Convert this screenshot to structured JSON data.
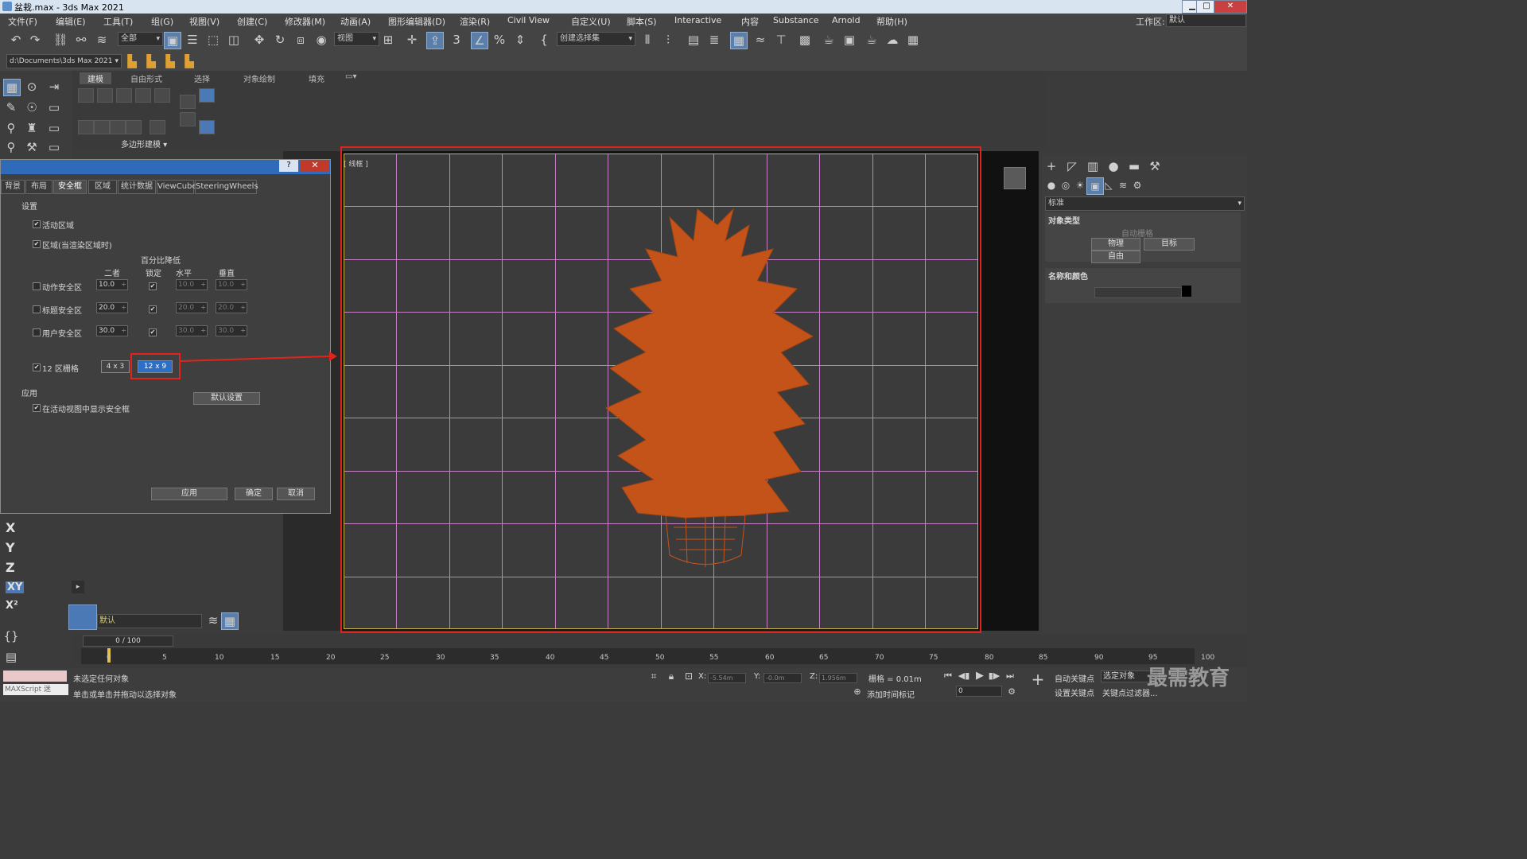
{
  "window": {
    "title": "盆栽.max - 3ds Max 2021",
    "min": "▁",
    "max": "□",
    "close": "✕"
  },
  "menu": [
    "文件(F)",
    "编辑(E)",
    "工具(T)",
    "组(G)",
    "视图(V)",
    "创建(C)",
    "修改器(M)",
    "动画(A)",
    "图形编辑器(D)",
    "渲染(R)",
    "Civil View",
    "自定义(U)",
    "脚本(S)",
    "Interactive",
    "内容",
    "Substance",
    "Arnold",
    "帮助(H)"
  ],
  "workspace": {
    "label": "工作区:",
    "value": "默认"
  },
  "toolbar": {
    "filter": "全部",
    "refcoord": "视图",
    "selset": "创建选择集"
  },
  "toolbar2": {
    "path": "d:\\Documents\\3ds Max 2021"
  },
  "ribbon": {
    "tabs": [
      "建模",
      "自由形式",
      "选择",
      "对象绘制",
      "填充"
    ],
    "group": "多边形建模 ▾"
  },
  "viewport": {
    "label": "[ 线框 ]"
  },
  "dialog": {
    "help": "?",
    "close": "✕",
    "tabs": [
      "背景",
      "布局",
      "安全框",
      "区域",
      "统计数据",
      "ViewCube",
      "SteeringWheels"
    ],
    "settings_label": "设置",
    "live_area": "活动区域",
    "region_render": "区域(当渲染区域时)",
    "pct_reduce": "百分比降低",
    "cols": [
      "二者",
      "锁定",
      "水平",
      "垂直"
    ],
    "rows": [
      {
        "label": "动作安全区",
        "both": "10.0",
        "h": "10.0",
        "v": "10.0"
      },
      {
        "label": "标题安全区",
        "both": "20.0",
        "h": "20.0",
        "v": "20.0"
      },
      {
        "label": "用户安全区",
        "both": "30.0",
        "h": "30.0",
        "v": "30.0"
      }
    ],
    "grid_label": "12 区栅格",
    "grid_opt1": "4 x 3",
    "grid_opt2": "12 x 9",
    "apply_label": "应用",
    "show_safe": "在活动视图中显示安全框",
    "default_btn": "默认设置",
    "btn_apply": "应用",
    "btn_ok": "确定",
    "btn_cancel": "取消",
    "check": "✔"
  },
  "cmdpanel": {
    "dropdown": "标准",
    "object_type": "对象类型",
    "autogrid": "自动栅格",
    "btn_physical": "物理",
    "btn_target": "目标",
    "btn_free": "自由",
    "name_color": "名称和颜色"
  },
  "axes": [
    "X",
    "Y",
    "Z",
    "XY",
    "X²"
  ],
  "layer": {
    "value": "默认"
  },
  "timeline": {
    "frame": "0 / 100",
    "ticks": [
      "0",
      "5",
      "10",
      "15",
      "20",
      "25",
      "30",
      "35",
      "40",
      "45",
      "50",
      "55",
      "60",
      "65",
      "70",
      "75",
      "80",
      "85",
      "90",
      "95",
      "100"
    ]
  },
  "status": {
    "line1": "未选定任何对象",
    "line2": "单击或单击并拖动以选择对象",
    "maxscript": "MAXScript 迷",
    "x_label": "X:",
    "x_val": "-5.54m",
    "y_label": "Y:",
    "y_val": "-0.0m",
    "z_label": "Z:",
    "z_val": "1.956m",
    "grid": "栅格 = 0.01m",
    "add_time_tag": "添加时间标记",
    "auto_key": "自动关键点",
    "selected": "选定对象",
    "set_key": "设置关键点",
    "key_filter": "关键点过滤器...",
    "frame_val": "0"
  },
  "colors": {
    "accent": "#2d6fc7",
    "grid": "#c27fc3",
    "plant": "#c4531a",
    "highlight": "#e1231b"
  },
  "watermark": "最需教育"
}
